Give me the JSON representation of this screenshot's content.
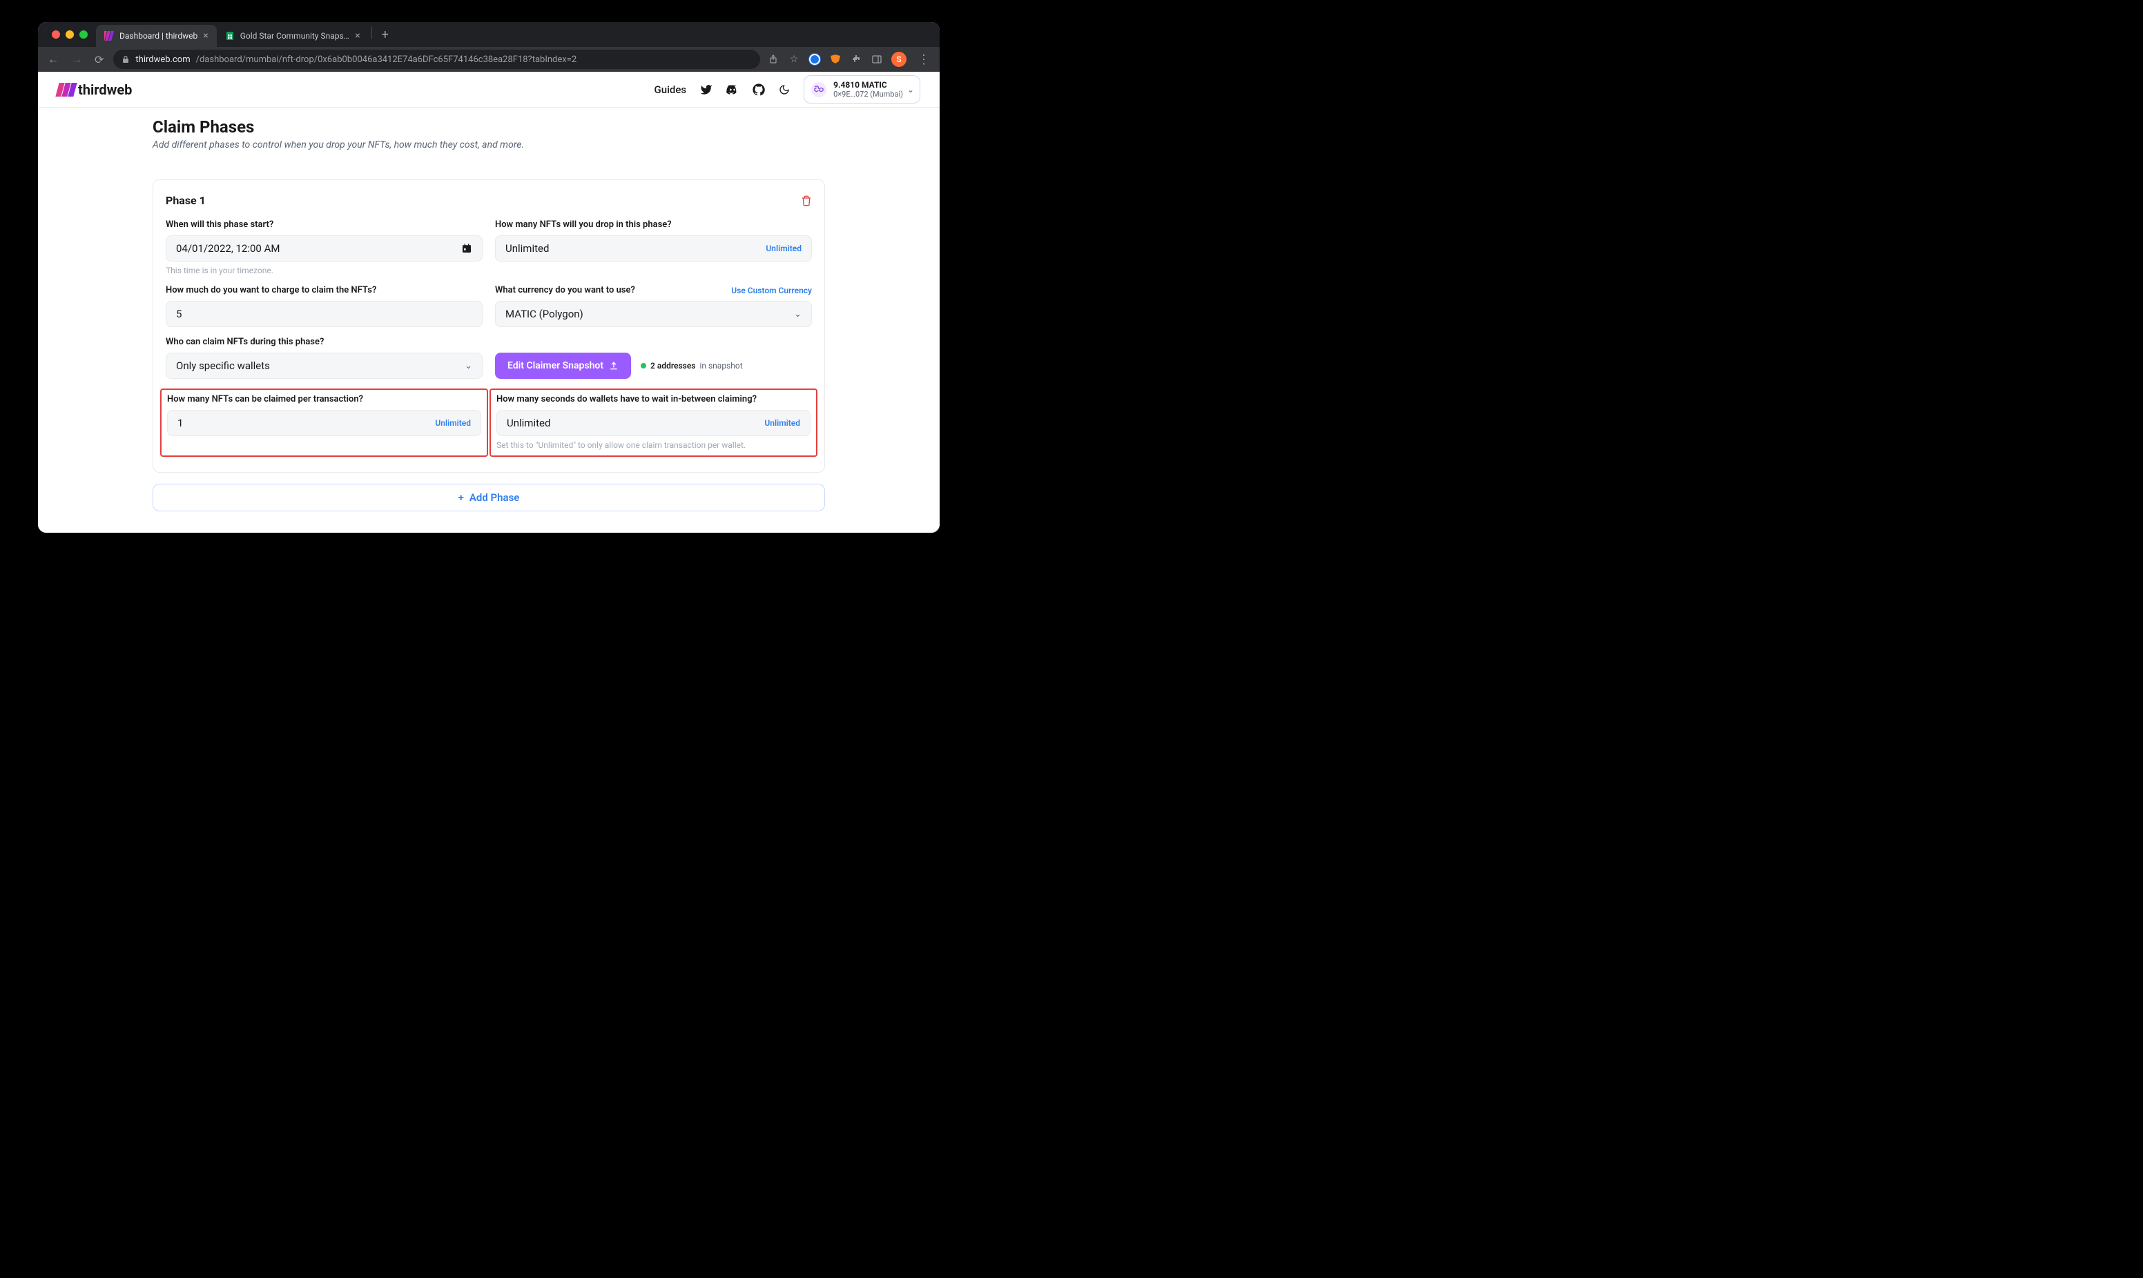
{
  "browser": {
    "tabs": [
      {
        "title": "Dashboard | thirdweb",
        "active": true
      },
      {
        "title": "Gold Star Community Snapsho",
        "active": false
      }
    ],
    "url_domain": "thirdweb.com",
    "url_path": "/dashboard/mumbai/nft-drop/0x6ab0b0046a3412E74a6DFc65F74146c38ea28F18?tabIndex=2",
    "avatar_letter": "S"
  },
  "header": {
    "logo_text": "thirdweb",
    "guides": "Guides",
    "wallet": {
      "balance": "9.4810 MATIC",
      "address": "0×9E…072 (Mumbai)"
    }
  },
  "page": {
    "title": "Claim Phases",
    "subtitle": "Add different phases to control when you drop your NFTs, how much they cost, and more."
  },
  "phase": {
    "name": "Phase 1",
    "start_label": "When will this phase start?",
    "start_value": "04/01/2022, 12:00 AM",
    "start_helper": "This time is in your timezone.",
    "drop_label": "How many NFTs will you drop in this phase?",
    "drop_value": "Unlimited",
    "drop_suffix": "Unlimited",
    "price_label": "How much do you want to charge to claim the NFTs?",
    "price_value": "5",
    "currency_label": "What currency do you want to use?",
    "currency_action": "Use Custom Currency",
    "currency_value": "MATIC (Polygon)",
    "who_label": "Who can claim NFTs during this phase?",
    "who_value": "Only specific wallets",
    "snapshot_btn": "Edit Claimer Snapshot",
    "snapshot_count": "2 addresses",
    "snapshot_suffix": "in snapshot",
    "pertx_label": "How many NFTs can be claimed per transaction?",
    "pertx_value": "1",
    "pertx_suffix": "Unlimited",
    "wait_label": "How many seconds do wallets have to wait in-between claiming?",
    "wait_value": "Unlimited",
    "wait_suffix": "Unlimited",
    "wait_helper": "Set this to \"Unlimited\" to only allow one claim transaction per wallet."
  },
  "add_phase": "Add Phase"
}
